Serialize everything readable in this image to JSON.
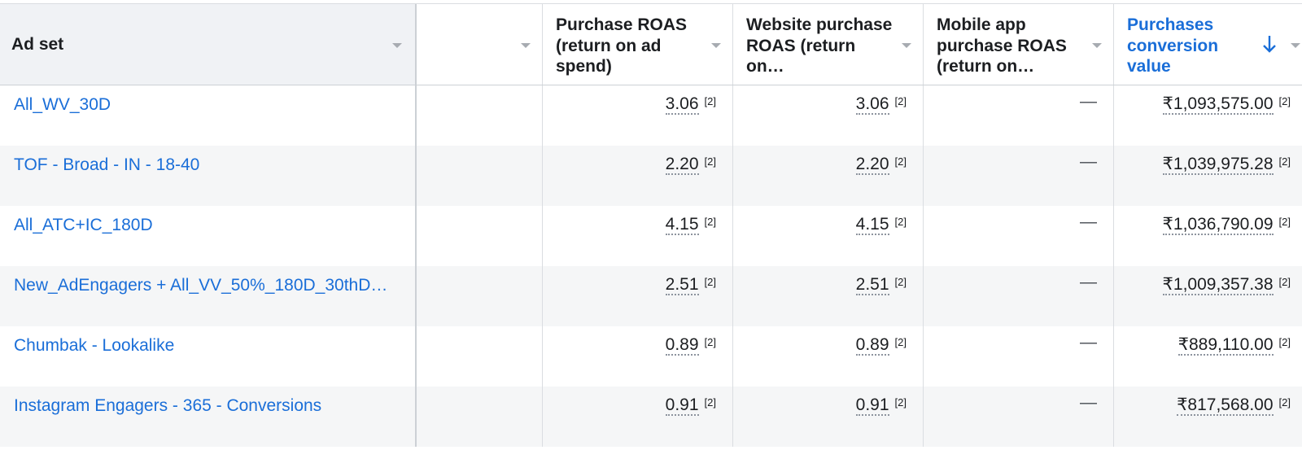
{
  "columns": {
    "ad_set": "Ad set",
    "blank": "",
    "purchase_roas": "Purchase ROAS (return on ad spend)",
    "website_purchase_roas": "Website purchase ROAS (return on…",
    "mobile_app_purchase_roas": "Mobile app purchase ROAS (return on…",
    "purchases_conversion_value": "Purchases conversion value"
  },
  "sort_icon": "arrow-down-icon",
  "dropdown_icon": "caret-down-icon",
  "accent_color": "#1a6ed8",
  "rows": [
    {
      "name": "All_WV_30D",
      "purchase_roas": "3.06",
      "purchase_roas_ref": "[2]",
      "website_roas": "3.06",
      "website_roas_ref": "[2]",
      "mobile_roas": "—",
      "conversion_value": "₹1,093,575.00",
      "conversion_value_ref": "[2]"
    },
    {
      "name": "TOF - Broad - IN - 18-40",
      "purchase_roas": "2.20",
      "purchase_roas_ref": "[2]",
      "website_roas": "2.20",
      "website_roas_ref": "[2]",
      "mobile_roas": "—",
      "conversion_value": "₹1,039,975.28",
      "conversion_value_ref": "[2]"
    },
    {
      "name": "All_ATC+IC_180D",
      "purchase_roas": "4.15",
      "purchase_roas_ref": "[2]",
      "website_roas": "4.15",
      "website_roas_ref": "[2]",
      "mobile_roas": "—",
      "conversion_value": "₹1,036,790.09",
      "conversion_value_ref": "[2]"
    },
    {
      "name": "New_AdEngagers + All_VV_50%_180D_30thD…",
      "purchase_roas": "2.51",
      "purchase_roas_ref": "[2]",
      "website_roas": "2.51",
      "website_roas_ref": "[2]",
      "mobile_roas": "—",
      "conversion_value": "₹1,009,357.38",
      "conversion_value_ref": "[2]"
    },
    {
      "name": "Chumbak - Lookalike",
      "purchase_roas": "0.89",
      "purchase_roas_ref": "[2]",
      "website_roas": "0.89",
      "website_roas_ref": "[2]",
      "mobile_roas": "—",
      "conversion_value": "₹889,110.00",
      "conversion_value_ref": "[2]"
    },
    {
      "name": "Instagram Engagers - 365 - Conversions",
      "purchase_roas": "0.91",
      "purchase_roas_ref": "[2]",
      "website_roas": "0.91",
      "website_roas_ref": "[2]",
      "mobile_roas": "—",
      "conversion_value": "₹817,568.00",
      "conversion_value_ref": "[2]"
    }
  ]
}
